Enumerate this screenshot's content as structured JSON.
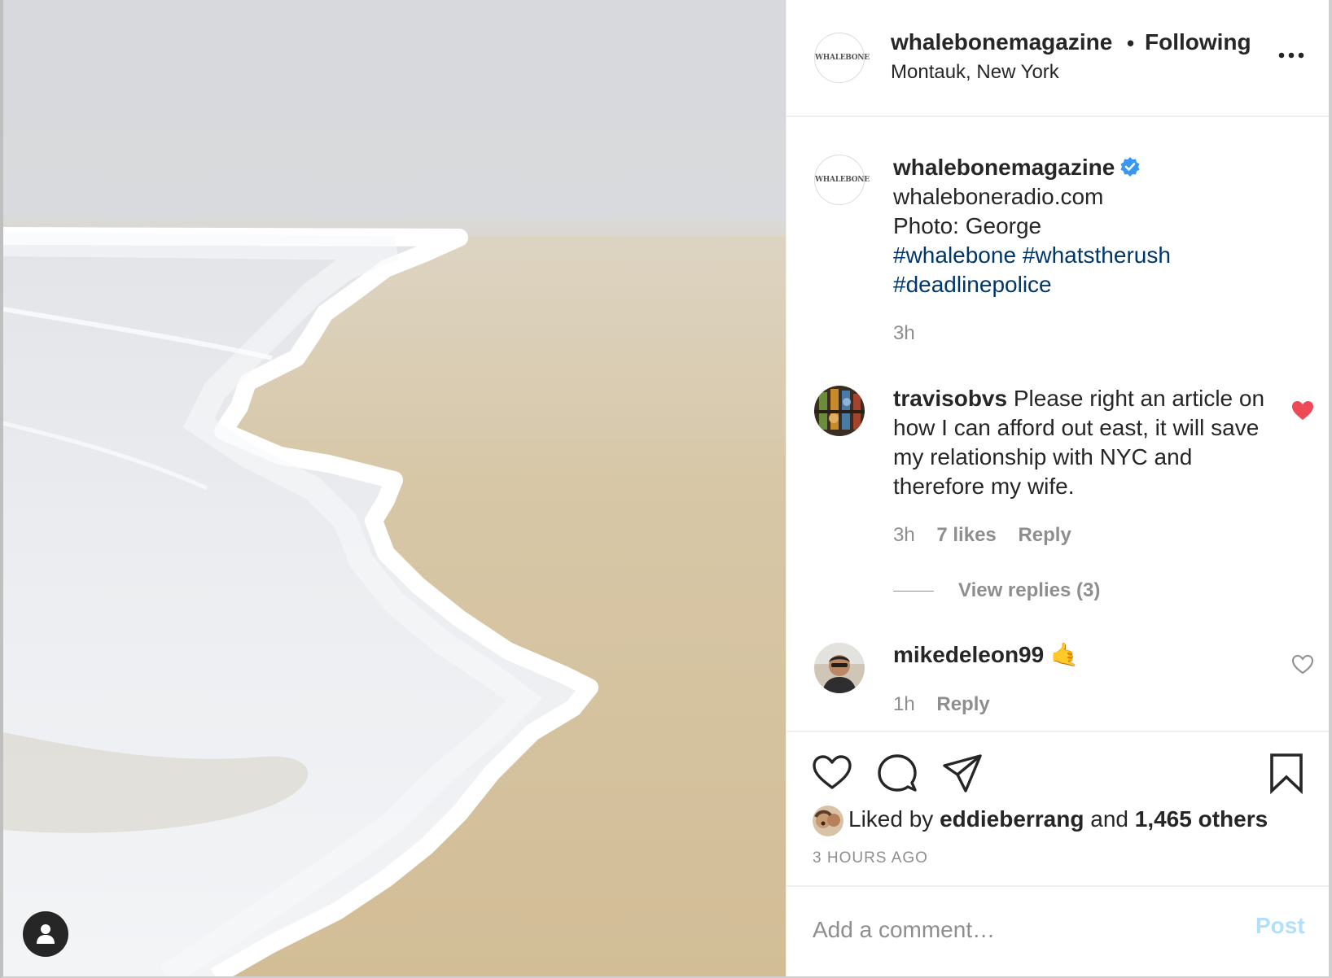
{
  "post": {
    "username": "whalebonemagazine",
    "follow_status": "Following",
    "separator": "•",
    "location": "Montauk, New York",
    "avatar_text": "WHALEBONE"
  },
  "caption": {
    "username": "whalebonemagazine",
    "lines": [
      "whaleboneradio.com",
      "Photo: George"
    ],
    "hashtags": [
      "#whalebone",
      "#whatstherush",
      "#deadlinepolice"
    ],
    "time": "3h"
  },
  "comments": [
    {
      "username": "travisobvs",
      "text": "Please right an article on how I can afford out east, it will save my relationship with NYC and therefore my wife.",
      "time": "3h",
      "likes": "7 likes",
      "reply_label": "Reply",
      "view_replies": "View replies (3)",
      "liked": true
    },
    {
      "username": "mikedeleon99",
      "text": "🤙",
      "time": "1h",
      "reply_label": "Reply",
      "liked": false
    }
  ],
  "likes": {
    "prefix": "Liked by",
    "user": "eddieberrang",
    "joiner": "and",
    "others": "1,465 others"
  },
  "post_age": "3 HOURS AGO",
  "comment_box": {
    "placeholder": "Add a comment…",
    "post_label": "Post"
  },
  "colors": {
    "liked_heart": "#ed4956",
    "verified": "#3897f0",
    "hashtag": "#00376b",
    "post_button_disabled": "#b2dffc",
    "secondary_text": "#8e8e8e"
  },
  "icons": {
    "more": "more-options-icon",
    "verified": "verified-badge-icon",
    "like": "heart-icon",
    "comment": "comment-bubble-icon",
    "share": "paper-plane-icon",
    "save": "bookmark-icon",
    "user_tag": "user-tag-icon"
  }
}
